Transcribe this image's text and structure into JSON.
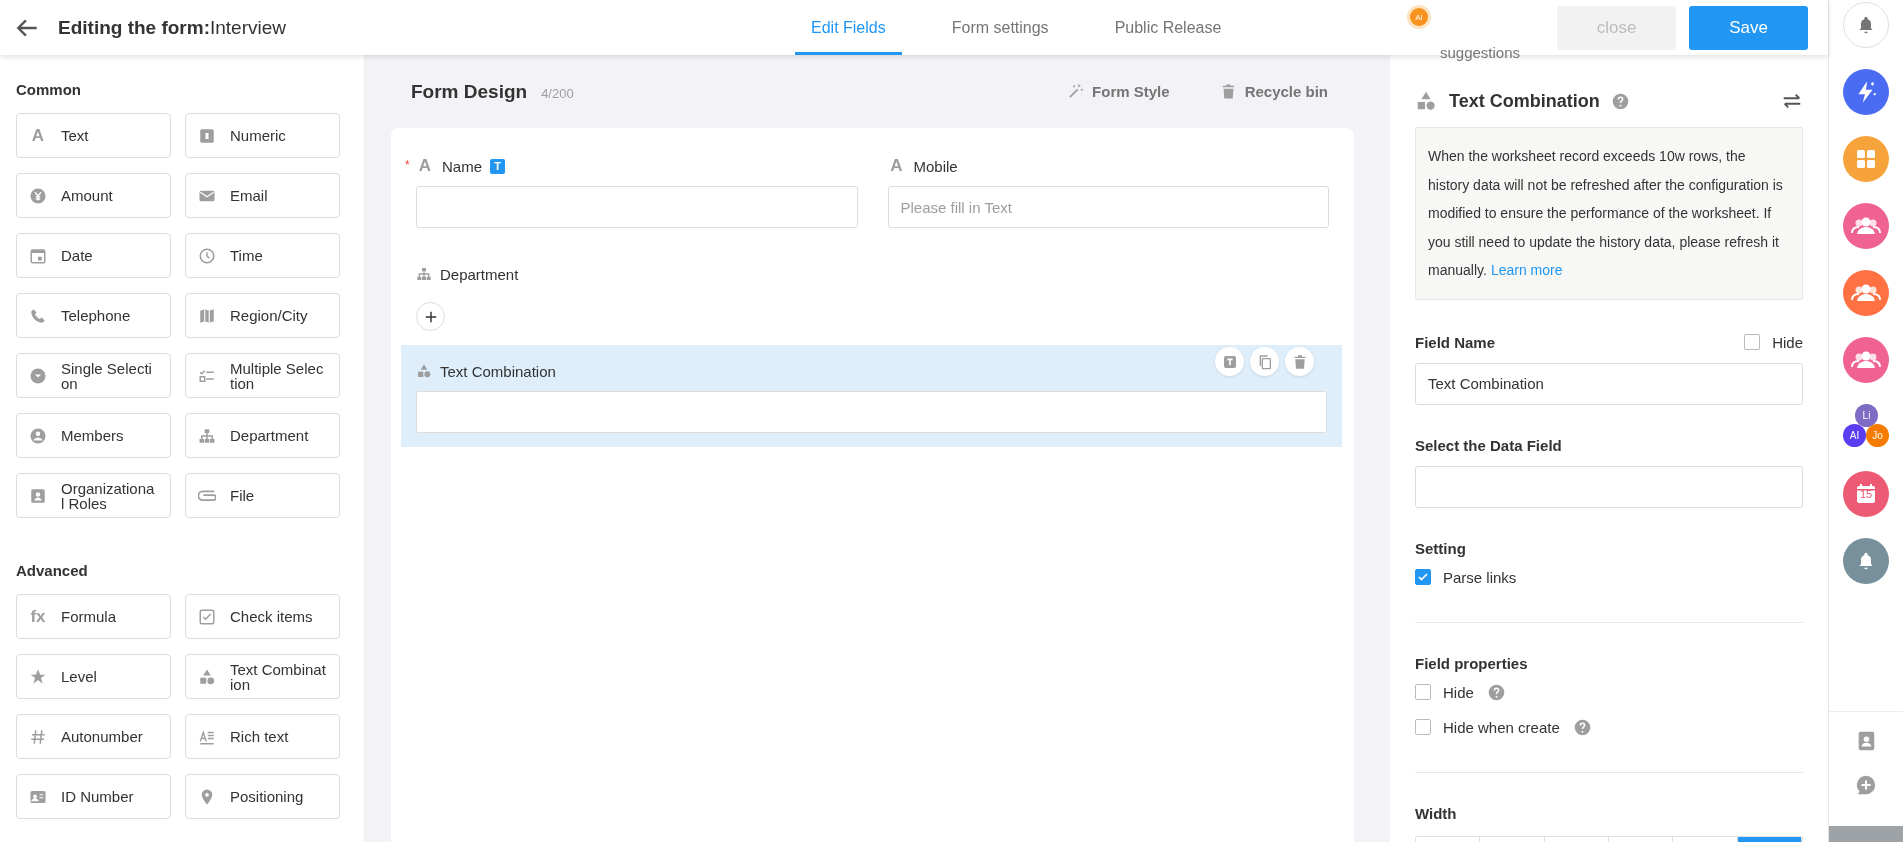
{
  "header": {
    "title": "**Editing the form:**Interview",
    "tabs": [
      {
        "label": "Edit Fields",
        "selected": true
      },
      {
        "label": "Form settings",
        "selected": false
      },
      {
        "label": "Public Release",
        "selected": false
      }
    ],
    "ai": {
      "badge": "AI",
      "label": "suggestions"
    },
    "buttons": [
      {
        "label": "close",
        "kind": "secondary"
      },
      {
        "label": "Save",
        "kind": "primary"
      }
    ]
  },
  "palette": [
    {
      "title": "Common",
      "items": [
        {
          "label": "Text",
          "kind": "text",
          "glyph": "A"
        },
        {
          "label": "Numeric",
          "kind": "numeric"
        },
        {
          "label": "Amount",
          "kind": "amount"
        },
        {
          "label": "Email",
          "kind": "email"
        },
        {
          "label": "Date",
          "kind": "date"
        },
        {
          "label": "Time",
          "kind": "time"
        },
        {
          "label": "Telephone",
          "kind": "telephone"
        },
        {
          "label": "Region/City",
          "kind": "region"
        },
        {
          "label": "Single Selection",
          "kind": "single"
        },
        {
          "label": "Multiple Selection",
          "kind": "multiple"
        },
        {
          "label": "Members",
          "kind": "members"
        },
        {
          "label": "Department",
          "kind": "department"
        },
        {
          "label": "Organizational Roles",
          "kind": "roles"
        },
        {
          "label": "File",
          "kind": "file"
        }
      ]
    },
    {
      "title": "Advanced",
      "items": [
        {
          "label": "Formula",
          "kind": "formula",
          "glyph": "fx"
        },
        {
          "label": "Check items",
          "kind": "check"
        },
        {
          "label": "Level",
          "kind": "level"
        },
        {
          "label": "Text Combination",
          "kind": "combination"
        },
        {
          "label": "Autonumber",
          "kind": "autonumber"
        },
        {
          "label": "Rich text",
          "kind": "richtext"
        },
        {
          "label": "ID Number",
          "kind": "idnumber"
        },
        {
          "label": "Positioning",
          "kind": "positioning"
        }
      ]
    }
  ],
  "form": {
    "title": "Form Design",
    "count": "4/200",
    "actions": [
      {
        "label": "Form Style",
        "kind": "wand"
      },
      {
        "label": "Recycle bin",
        "kind": "trash"
      }
    ],
    "fields": [
      {
        "label": "Name",
        "kind": "text",
        "glyph": "A",
        "required_mark": "*",
        "badge": "T",
        "selected": false
      },
      {
        "label": "Mobile",
        "kind": "text",
        "glyph": "A",
        "placeholder": "Please fill in Text",
        "selected": false
      },
      {
        "label": "Department",
        "kind": "department",
        "selected": false
      },
      {
        "label": "Text Combination",
        "kind": "combination",
        "selected": true
      }
    ]
  },
  "settings": {
    "title": "Text Combination",
    "notice": "When the worksheet record exceeds 10w rows, the history data will not be refreshed after the configuration is modified to ensure the performance of the worksheet. If you still need to update the history data, please refresh it manually.",
    "notice_link": "Learn more",
    "field_name": {
      "label": "Field Name",
      "hide_label": "Hide",
      "hidden": false,
      "value": "Text Combination"
    },
    "data_field": {
      "label": "Select the Data Field"
    },
    "setting": {
      "label": "Setting",
      "options": [
        {
          "label": "Parse links",
          "checked": true
        }
      ]
    },
    "properties": {
      "label": "Field properties",
      "options": [
        {
          "label": "Hide",
          "checked": false
        },
        {
          "label": "Hide when create",
          "checked": false
        }
      ]
    },
    "width": {
      "label": "Width",
      "segments": [
        {
          "selected": false
        },
        {
          "selected": false
        },
        {
          "selected": false
        },
        {
          "selected": false
        },
        {
          "selected": false
        },
        {
          "selected": true
        }
      ]
    }
  },
  "rail": [
    {
      "kind": "bell",
      "color": "#ffffff"
    },
    {
      "kind": "bolt",
      "color": "#4a6cf2"
    },
    {
      "kind": "grid",
      "color": "#f7a33b"
    },
    {
      "kind": "people",
      "color": "#f06292"
    },
    {
      "kind": "people",
      "color": "#ff7043"
    },
    {
      "kind": "people",
      "color": "#f06292"
    },
    {
      "kind": "avatars",
      "avatars": [
        {
          "text": "Li",
          "color": "#7e6bc4"
        },
        {
          "text": "AI",
          "color": "#5b3cf0"
        },
        {
          "text": "Jo",
          "color": "#f57c00"
        }
      ]
    },
    {
      "kind": "calendar",
      "color": "#ec5a74",
      "text": "15"
    },
    {
      "kind": "bell",
      "color": "#78909c"
    }
  ]
}
